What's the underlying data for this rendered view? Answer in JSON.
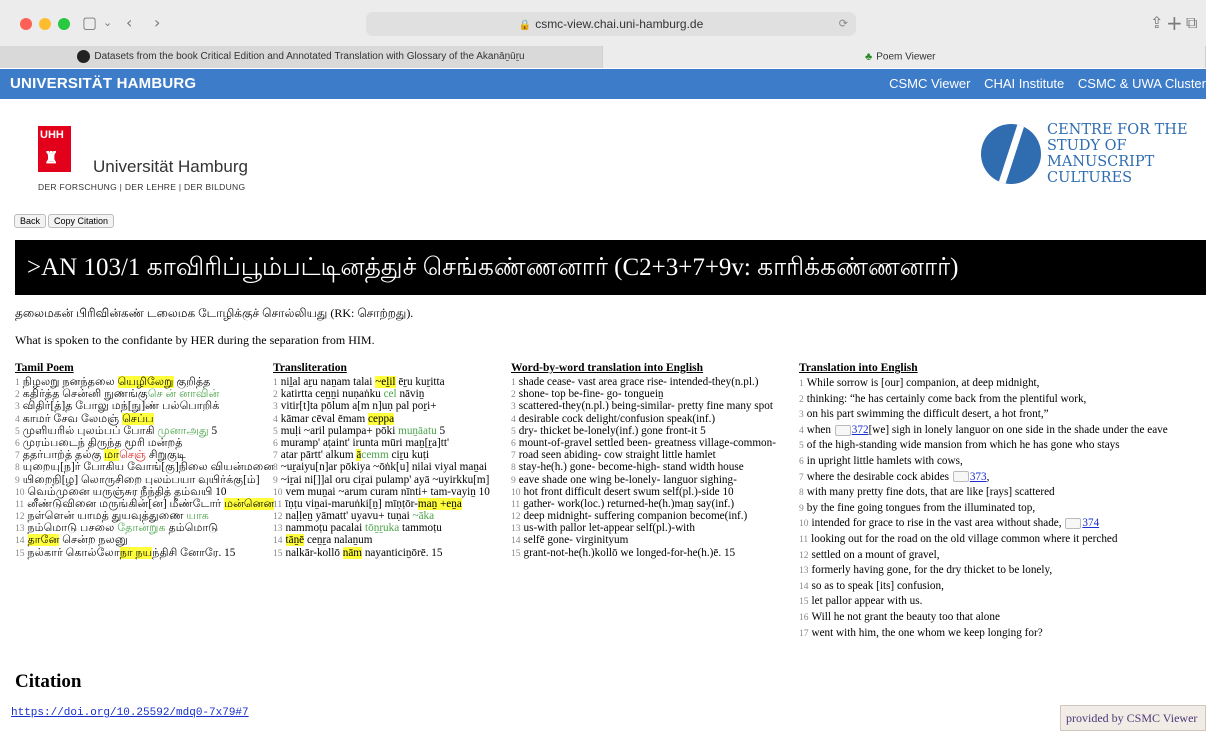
{
  "browser": {
    "url": "csmc-view.chai.uni-hamburg.de",
    "tabs": [
      {
        "label": "Datasets from the book Critical Edition and Annotated Translation with Glossary of the Akanāṉūṟu"
      },
      {
        "label": "Poem Viewer"
      }
    ]
  },
  "header": {
    "brand": "UNIVERSITÄT HAMBURG",
    "nav": [
      "CSMC Viewer",
      "CHAI Institute",
      "CSMC & UWA Cluster"
    ]
  },
  "logos": {
    "uhh_mark": "UHH",
    "uhh_name": "Universität Hamburg",
    "uhh_tagline": "DER FORSCHUNG | DER LEHRE | DER BILDUNG",
    "csmc_lines": [
      "CENTRE FOR THE",
      "STUDY OF",
      "MANUSCRIPT",
      "CULTURES"
    ]
  },
  "buttons": {
    "back": "Back",
    "copy": "Copy Citation"
  },
  "poem": {
    "title": ">AN 103/1 காவிரிப்பூம்பட்டினத்துச் செங்கண்ணனார் (C2+3+7+9v: காரிக்கண்ணனார்)",
    "colophon": "தலைமகன் பிரிவின்கண் டலைமக டோழிக்குச் சொல்லியது (RK: சொற்றது).",
    "spoken": "What is spoken to the confidante by HER during the separation from HIM."
  },
  "columns": {
    "tamil_header": "Tamil Poem",
    "translit_header": "Transliteration",
    "wbw_header": "Word-by-word translation into English",
    "trans_header": "Translation into English"
  },
  "tamil": [
    {
      "n": "1",
      "a": "நிழலறு நனந்தலை ",
      "h": "யெழிலேறு",
      "b": " குறித்த"
    },
    {
      "n": "2",
      "a": "கதிர்த்த சென்னி நுணங்கு",
      "g": "செ ன் னாவின்"
    },
    {
      "n": "3",
      "a": "விதிர்[த்]த போலு மந்[நு]ண் பல்பொறிக்"
    },
    {
      "n": "4",
      "a": "காமர் சேவ லேமஞ் ",
      "h": "செப்ப"
    },
    {
      "n": "5",
      "a": "முளியரில் புலம்பப் போகி ",
      "g": "முனாஅது",
      "b": " 5"
    },
    {
      "n": "6",
      "a": "முரம்படைந் திருந்த மூரி மன்றத்"
    },
    {
      "n": "7",
      "a": "ததர்பாற்த் தல்கு ",
      "h": "மா",
      "r": "செஞ்",
      "b": " சிறுகுடி"
    },
    {
      "n": "8",
      "a": "யுறையு[ந]ர் போகிய வோங்[கு]நிலை வியன்மனை"
    },
    {
      "n": "9",
      "a": "யிறைநி[ழ] லொருசிறை புலம்பயா வுயிர்க்கு[ம்]"
    },
    {
      "n": "10",
      "a": "வெம்முனை யருஞ்சுர நீந்தித் தம்வயி 10"
    },
    {
      "n": "11",
      "a": "னீண்டுவினை மருங்கின்[ன] மீண்டோர் ",
      "h": "மன்னென"
    },
    {
      "n": "12",
      "a": "நள்ளென் யாமத் துயவுத்துணை ",
      "g": "யாக"
    },
    {
      "n": "13",
      "a": "நம்மொடு பசலை ",
      "g": "தோன்றுக",
      "b": " தம்மொடு"
    },
    {
      "n": "14",
      "a": "",
      "h": "தானே",
      "b": " சென்ற நலனு"
    },
    {
      "n": "15",
      "a": "நல்கார் கொல்லோ",
      "h": "நா நய",
      "b": "ந்திசி னோரே. 15"
    }
  ],
  "translit": [
    {
      "n": "1",
      "a": "niḻal aṟu naṉam talai ",
      "h": "~eḻil",
      "b": " ēṟu kuṟitta"
    },
    {
      "n": "2",
      "a": "katirtta ceṉṉi nuṇaṅku ",
      "g": "cel",
      "b": " nāviṉ"
    },
    {
      "n": "3",
      "a": "vitir[t]ta pōlum a[m n]uṇ pal poṟi+"
    },
    {
      "n": "4",
      "a": "kāmar cēval ēmam ",
      "h": "ceppa"
    },
    {
      "n": "5",
      "a": "muḷi ~aril pulampa+ pōki ",
      "g": "muṉāatu",
      "b": " 5"
    },
    {
      "n": "6",
      "a": "muramp' aṭaint' irunta mūri maṉ[ṟa]tt'"
    },
    {
      "n": "7",
      "a": "atar pārtt' alkum ",
      "h": "ā",
      "g": "cemm",
      "b": " ciṟu kuṭi"
    },
    {
      "n": "8",
      "a": "~uṟaiyu[n]ar pōkiya ~ōṅk[u] nilai viyal maṉai"
    },
    {
      "n": "9",
      "a": "~iṟai ni[]]al oru ciṟai pulamp' ayā ~uyirkku[m]"
    },
    {
      "n": "10",
      "a": "vem muṉai ~arum curam nīnti+ tam-vayiṉ 10"
    },
    {
      "n": "11",
      "a": "īṇṭu viṉai-maruṅki[ṉ] mīṇṭōr-",
      "h": "maṉ +eṉa"
    },
    {
      "n": "12",
      "a": "naḷḷeṉ yāmatt' uyavu+ tuṇai ",
      "g": "~āka"
    },
    {
      "n": "13",
      "a": "nammoṭu pacalai ",
      "g": "tōṉṟuka",
      "b": " tammoṭu"
    },
    {
      "n": "14",
      "a": "",
      "h": "tāṉē",
      "b": " ceṉṟa nalaṉum"
    },
    {
      "n": "15",
      "a": "nalkār-kollō ",
      "h": "nām",
      "b": " nayanticiṉōrē. 15"
    }
  ],
  "wbw": [
    {
      "n": "1",
      "a": "shade cease- vast area grace rise- intended-they(n.pl.)"
    },
    {
      "n": "2",
      "a": "shone- top be-fine- go- tongueiṉ"
    },
    {
      "n": "3",
      "a": "scattered-they(n.pl.) being-similar- pretty fine many spot"
    },
    {
      "n": "4",
      "a": "desirable cock delight/confusion speak(inf.)"
    },
    {
      "n": "5",
      "a": "dry- thicket be-lonely(inf.) gone front-it 5"
    },
    {
      "n": "6",
      "a": "mount-of-gravel settled been- greatness village-common-"
    },
    {
      "n": "7",
      "a": "road seen abiding- cow straight little hamlet"
    },
    {
      "n": "8",
      "a": "stay-he(h.) gone- become-high- stand width house"
    },
    {
      "n": "9",
      "a": "eave shade one wing be-lonely- languor sighing-"
    },
    {
      "n": "10",
      "a": "hot front difficult desert swum self(pl.)-side 10"
    },
    {
      "n": "11",
      "a": "gather- work(loc.) returned-he(h.)maṉ say(inf.)"
    },
    {
      "n": "12",
      "a": "deep midnight- suffering companion become(inf.)"
    },
    {
      "n": "13",
      "a": "us-with pallor let-appear self(pl.)-with"
    },
    {
      "n": "14",
      "a": "selfē gone- virginityum"
    },
    {
      "n": "15",
      "a": "grant-not-he(h.)kollō we longed-for-he(h.)ē. 15"
    }
  ],
  "translation": [
    {
      "n": "1",
      "a": "While sorrow is [our] companion, at deep midnight,"
    },
    {
      "n": "2",
      "a": "thinking: “he has certainly come back from the plentiful work,"
    },
    {
      "n": "3",
      "a": "on his part swimming the difficult desert, a hot front,”"
    },
    {
      "n": "4",
      "a": "when ",
      "link": "372",
      "b": "[we] sigh in lonely languor on one side in the shade under the eave"
    },
    {
      "n": "5",
      "a": "of the high-standing wide mansion from which he has gone who stays"
    },
    {
      "n": "6",
      "a": "in upright little hamlets with cows,"
    },
    {
      "n": "7",
      "a": "where the desirable cock abides ",
      "link": "373",
      "b": ","
    },
    {
      "n": "8",
      "a": "with many pretty fine dots, that are like [rays] scattered"
    },
    {
      "n": "9",
      "a": "by the fine going tongues from the illuminated top,"
    },
    {
      "n": "10",
      "a": "intended for grace to rise in the vast area without shade, ",
      "link": "374",
      "b": ""
    },
    {
      "n": "11",
      "a": "looking out for the road on the old village common where it perched"
    },
    {
      "n": "12",
      "a": "settled on a mount of gravel,"
    },
    {
      "n": "13",
      "a": "formerly having gone, for the dry thicket to be lonely,"
    },
    {
      "n": "14",
      "a": "so as to speak [its] confusion,"
    },
    {
      "n": "15",
      "a": "let pallor appear with us."
    },
    {
      "n": "16",
      "a": "Will he not grant the beauty too that alone"
    },
    {
      "n": "17",
      "a": "went with him, the one whom we keep longing for?"
    }
  ],
  "citation": {
    "heading": "Citation",
    "doi": "https://doi.org/10.25592/mdq0-7x79#7"
  },
  "footer": {
    "provided": "provided by CSMC Viewer"
  }
}
